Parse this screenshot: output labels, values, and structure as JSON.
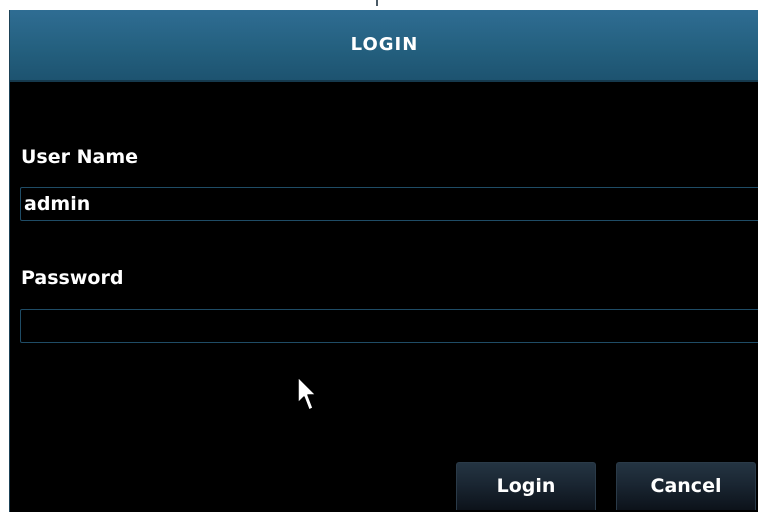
{
  "dialog": {
    "title": "LOGIN",
    "username": {
      "label": "User Name",
      "value": "admin"
    },
    "password": {
      "label": "Password",
      "value": ""
    },
    "buttons": {
      "login": "Login",
      "cancel": "Cancel"
    }
  },
  "colors": {
    "title_bar": "#24607f",
    "background": "#000000",
    "field_border": "#1f4c66",
    "text": "#ffffff"
  },
  "icons": {
    "cursor": "mouse-pointer-icon"
  }
}
